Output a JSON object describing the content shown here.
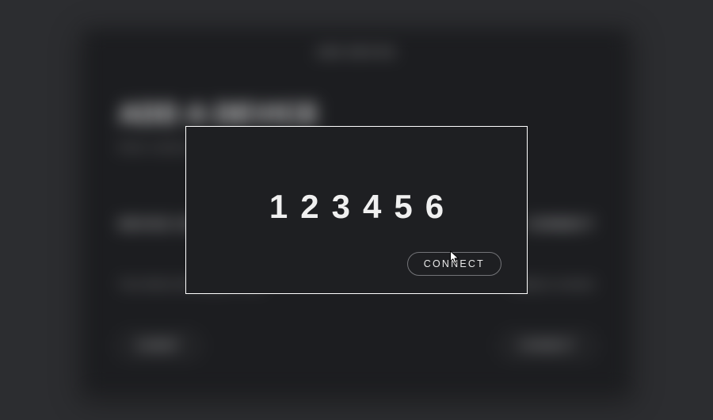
{
  "background": {
    "top_label": "ADD DEVICE",
    "heading": "ADD A DEVICE",
    "sub": "Enter a device code to connect.",
    "left_label": "DEVICE CODE",
    "right_label": "CONNECT",
    "body_left": "Your device will display a code",
    "body_right": "Ready to connect",
    "pill_left": "SUBMIT",
    "pill_right": "CONNECT"
  },
  "modal": {
    "code": "123456",
    "connect_label": "CONNECT"
  }
}
